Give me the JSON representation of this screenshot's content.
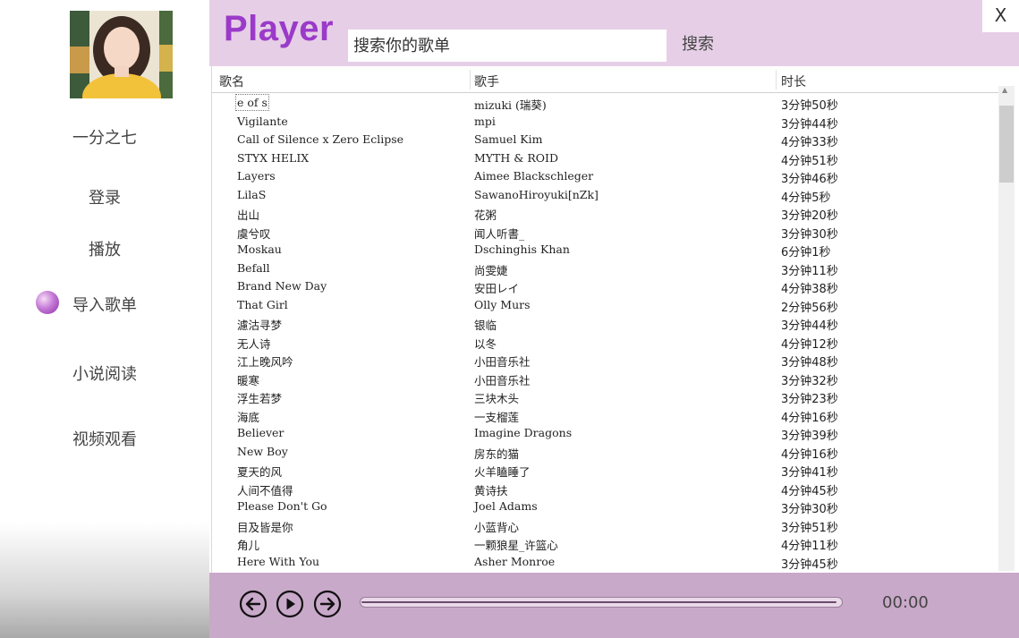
{
  "sidebar": {
    "username": "一分之七",
    "nav": [
      {
        "label": "登录"
      },
      {
        "label": "播放"
      },
      {
        "label": "导入歌单"
      },
      {
        "label": "小说阅读"
      },
      {
        "label": "视频观看"
      }
    ],
    "active_index": 2
  },
  "header": {
    "title": "Player",
    "search_placeholder": "搜索你的歌单",
    "search_label": "搜索",
    "close_label": "X"
  },
  "table": {
    "columns": {
      "name": "歌名",
      "artist": "歌手",
      "duration": "时长"
    },
    "selected_index": 0,
    "rows": [
      {
        "name": "e of s",
        "artist": "mizuki (瑞葵)",
        "duration": "3分钟50秒"
      },
      {
        "name": "Vigilante",
        "artist": "mpi",
        "duration": "3分钟44秒"
      },
      {
        "name": "Call of Silence x Zero Eclipse",
        "artist": "Samuel Kim",
        "duration": "4分钟33秒"
      },
      {
        "name": "STYX HELIX",
        "artist": "MYTH & ROID",
        "duration": "4分钟51秒"
      },
      {
        "name": "Layers",
        "artist": "Aimee Blackschleger",
        "duration": "3分钟46秒"
      },
      {
        "name": "LilaS",
        "artist": "SawanoHiroyuki[nZk]",
        "duration": "4分钟5秒"
      },
      {
        "name": "出山",
        "artist": "花粥",
        "duration": "3分钟20秒"
      },
      {
        "name": "虞兮叹",
        "artist": "闻人听書_",
        "duration": "3分钟30秒"
      },
      {
        "name": "Moskau",
        "artist": "Dschinghis Khan",
        "duration": "6分钟1秒"
      },
      {
        "name": "Befall",
        "artist": "尚雯婕",
        "duration": "3分钟11秒"
      },
      {
        "name": "Brand New Day",
        "artist": "安田レイ",
        "duration": "4分钟38秒"
      },
      {
        "name": "That Girl",
        "artist": "Olly Murs",
        "duration": "2分钟56秒"
      },
      {
        "name": "濾沽寻梦",
        "artist": "银临",
        "duration": "3分钟44秒"
      },
      {
        "name": "无人诗",
        "artist": "以冬",
        "duration": "4分钟12秒"
      },
      {
        "name": "江上晚风吟",
        "artist": "小田音乐社",
        "duration": "3分钟48秒"
      },
      {
        "name": "暖寒",
        "artist": "小田音乐社",
        "duration": "3分钟32秒"
      },
      {
        "name": "浮生若梦",
        "artist": "三块木头",
        "duration": "3分钟23秒"
      },
      {
        "name": "海底",
        "artist": "一支榴莲",
        "duration": "4分钟16秒"
      },
      {
        "name": "Believer",
        "artist": "Imagine Dragons",
        "duration": "3分钟39秒"
      },
      {
        "name": "New Boy",
        "artist": "房东的猫",
        "duration": "4分钟16秒"
      },
      {
        "name": "夏天的风",
        "artist": "火羊瞌睡了",
        "duration": "3分钟41秒"
      },
      {
        "name": "人间不值得",
        "artist": "黄诗扶",
        "duration": "4分钟45秒"
      },
      {
        "name": "Please Don't Go",
        "artist": "Joel Adams",
        "duration": "3分钟30秒"
      },
      {
        "name": "目及皆是你",
        "artist": "小蓝背心",
        "duration": "3分钟51秒"
      },
      {
        "name": "角儿",
        "artist": "一颗狼星_许篮心",
        "duration": "4分钟11秒"
      },
      {
        "name": "Here With You",
        "artist": "Asher Monroe",
        "duration": "3分钟45秒"
      }
    ]
  },
  "player": {
    "time": "00:00",
    "progress": 0.99,
    "icons": {
      "prev": "arrow-left-circle-icon",
      "play": "play-circle-icon",
      "next": "arrow-right-circle-icon"
    }
  },
  "colors": {
    "header_bg": "#e6cfe6",
    "title": "#9b3ac9",
    "player_bg": "#c9a9c9",
    "accent": "#a347c2"
  }
}
